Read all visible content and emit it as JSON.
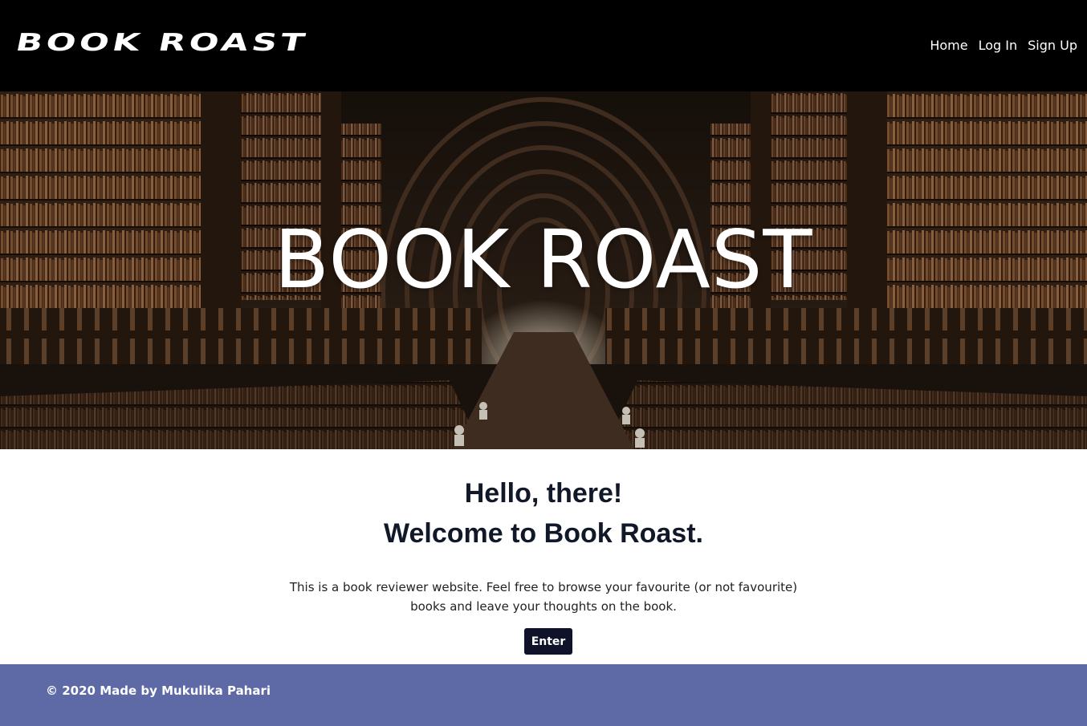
{
  "navbar": {
    "brand": "BOOK ROAST",
    "links": [
      "Home",
      "Log In",
      "Sign Up"
    ]
  },
  "hero": {
    "title": "BOOK ROAST"
  },
  "welcome": {
    "greeting": "Hello, there!",
    "heading": "Welcome to Book Roast.",
    "description": "This is a book reviewer website. Feel free to browse your favourite (or not favourite) books and leave your thoughts on the book.",
    "button_label": "Enter"
  },
  "footer": {
    "text": "© 2020 Made by Mukulika Pahari"
  },
  "colors": {
    "navbar": "#000000",
    "button": "#0f1229",
    "footer": "#5d6aa6",
    "text_dark": "#111827"
  }
}
